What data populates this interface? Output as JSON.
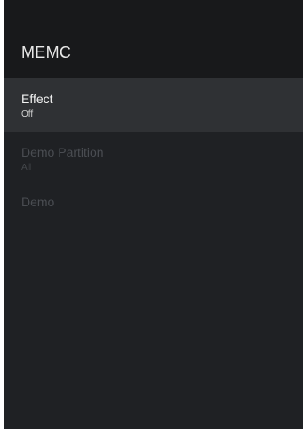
{
  "header": {
    "title": "MEMC"
  },
  "menu": {
    "items": [
      {
        "label": "Effect",
        "value": "Off",
        "state": "selected"
      },
      {
        "label": "Demo Partition",
        "value": "All",
        "state": "disabled"
      },
      {
        "label": "Demo",
        "state": "disabled"
      }
    ]
  },
  "colors": {
    "panel_background": "#1f2124",
    "header_background": "#18191b",
    "selected_row": "#2f3134",
    "enabled_text": "#f2f2f2",
    "disabled_text": "#4a4d52"
  }
}
